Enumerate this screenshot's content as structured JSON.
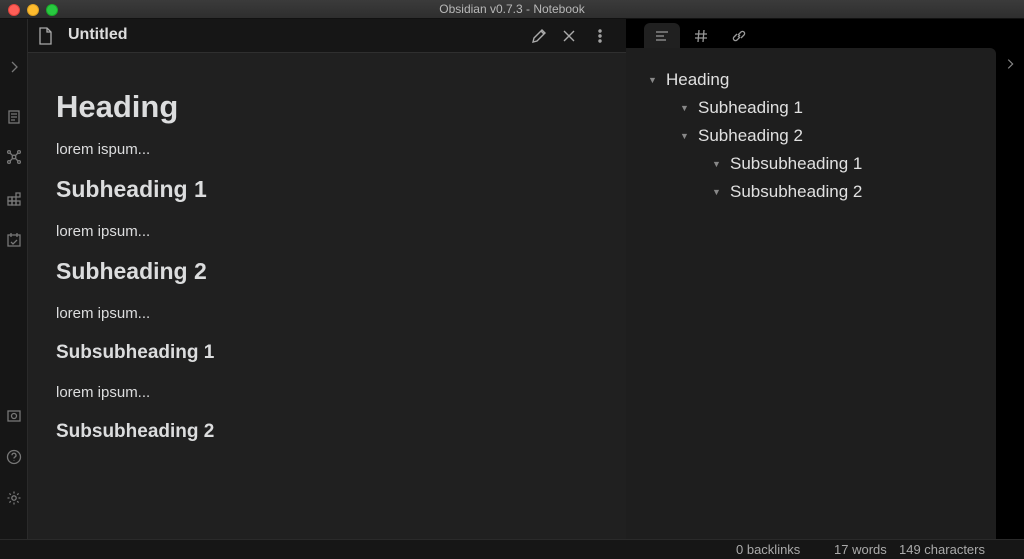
{
  "window": {
    "title": "Obsidian v0.7.3 - Notebook"
  },
  "ribbon": {
    "icons": [
      "expand-sidebar-icon",
      "open-file-icon",
      "graph-view-icon",
      "templates-icon",
      "daily-note-icon",
      "vault-icon",
      "help-icon",
      "settings-icon"
    ]
  },
  "editor": {
    "title": "Untitled",
    "actions": [
      "edit-icon",
      "close-icon",
      "more-options-icon"
    ],
    "content": {
      "heading": "Heading",
      "p1": "lorem ispum...",
      "sub1": "Subheading 1",
      "p2": "lorem ipsum...",
      "sub2": "Subheading 2",
      "p3": "lorem ipsum...",
      "subsub1": "Subsubheading 1",
      "p4": "lorem ipsum...",
      "subsub2": "Subsubheading 2"
    }
  },
  "sidebar": {
    "tabs": [
      "outline-icon",
      "tags-icon",
      "backlinks-icon"
    ],
    "outline": [
      {
        "label": "Heading",
        "level": 1
      },
      {
        "label": "Subheading 1",
        "level": 2
      },
      {
        "label": "Subheading 2",
        "level": 2
      },
      {
        "label": "Subsubheading 1",
        "level": 3
      },
      {
        "label": "Subsubheading 2",
        "level": 3
      }
    ]
  },
  "status": {
    "backlinks": "0 backlinks",
    "words": "17 words",
    "characters": "149 characters"
  }
}
